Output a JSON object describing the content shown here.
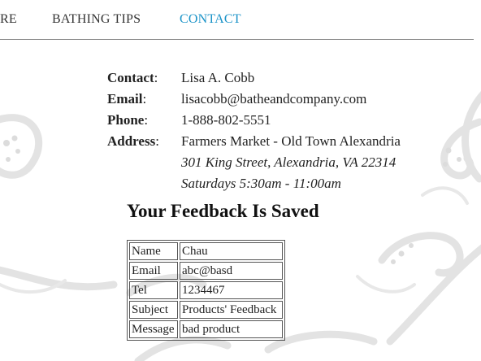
{
  "nav": {
    "items": [
      {
        "label": "RE"
      },
      {
        "label": "BATHING TIPS"
      },
      {
        "label": "CONTACT"
      }
    ],
    "active_color": "#1a93c8"
  },
  "contact": {
    "contact_label": "Contact",
    "contact_value": "Lisa A. Cobb",
    "email_label": "Email",
    "email_value": "lisacobb@batheandcompany.com",
    "phone_label": "Phone",
    "phone_value": "1-888-802-5551",
    "address_label": "Address",
    "address_line1": "Farmers Market - Old Town Alexandria",
    "address_line2": "301 King Street, Alexandria, VA 22314",
    "address_line3": "Saturdays 5:30am - 11:00am"
  },
  "feedback": {
    "title": "Your Feedback Is Saved",
    "rows": [
      {
        "field": "Name",
        "value": "Chau"
      },
      {
        "field": "Email",
        "value": "abc@basd"
      },
      {
        "field": "Tel",
        "value": "1234467"
      },
      {
        "field": "Subject",
        "value": "Products' Feedback"
      },
      {
        "field": "Message",
        "value": "bad product"
      }
    ]
  }
}
